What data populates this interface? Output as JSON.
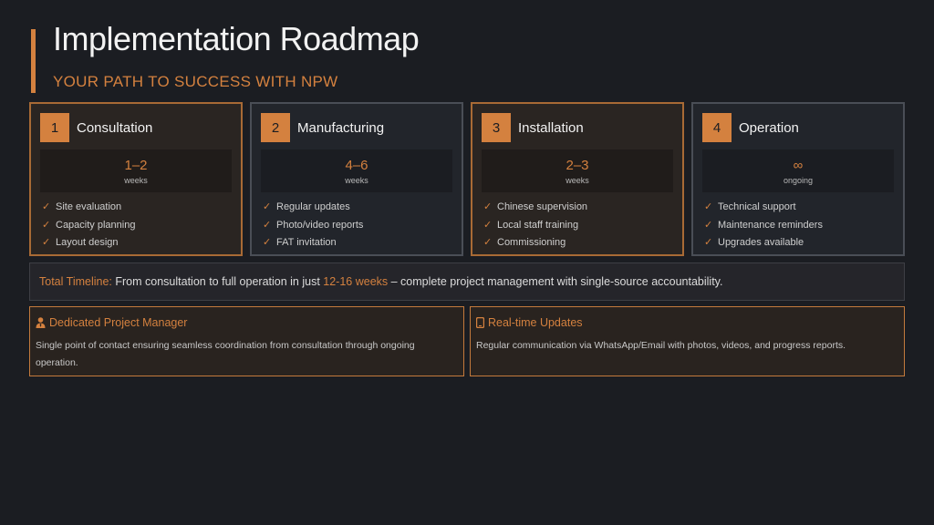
{
  "header": {
    "title": "Implementation Roadmap",
    "subtitle": "YOUR PATH TO SUCCESS WITH NPW"
  },
  "phases": [
    {
      "number": "1",
      "name": "Consultation",
      "duration": "1–2",
      "unit": "weeks",
      "items": [
        "Site evaluation",
        "Capacity planning",
        "Layout design"
      ]
    },
    {
      "number": "2",
      "name": "Manufacturing",
      "duration": "4–6",
      "unit": "weeks",
      "items": [
        "Regular updates",
        "Photo/video reports",
        "FAT invitation"
      ]
    },
    {
      "number": "3",
      "name": "Installation",
      "duration": "2–3",
      "unit": "weeks",
      "items": [
        "Chinese supervision",
        "Local staff training",
        "Commissioning"
      ]
    },
    {
      "number": "4",
      "name": "Operation",
      "duration": "∞",
      "unit": "ongoing",
      "items": [
        "Technical support",
        "Maintenance reminders",
        "Upgrades available"
      ]
    }
  ],
  "check_glyph": "✓",
  "timeline": {
    "label": "Total Timeline:",
    "text_before": " From consultation to full operation in just ",
    "highlight": "12-16 weeks",
    "text_after": " – complete project management with single-source accountability."
  },
  "cards": {
    "manager": {
      "icon": "user-tie-icon",
      "title": "Dedicated Project Manager",
      "description": "Single point of contact ensuring seamless coordination from consultation through ongoing operation."
    },
    "updates": {
      "icon": "mobile-phone-icon",
      "title": "Real-time Updates",
      "description": "Regular communication via WhatsApp/Email with photos, videos, and progress reports."
    }
  },
  "colors": {
    "accent": "#d4813f",
    "background": "#1b1d22",
    "card_border": "#4a4e56",
    "card_border_warm": "#a86a35"
  }
}
